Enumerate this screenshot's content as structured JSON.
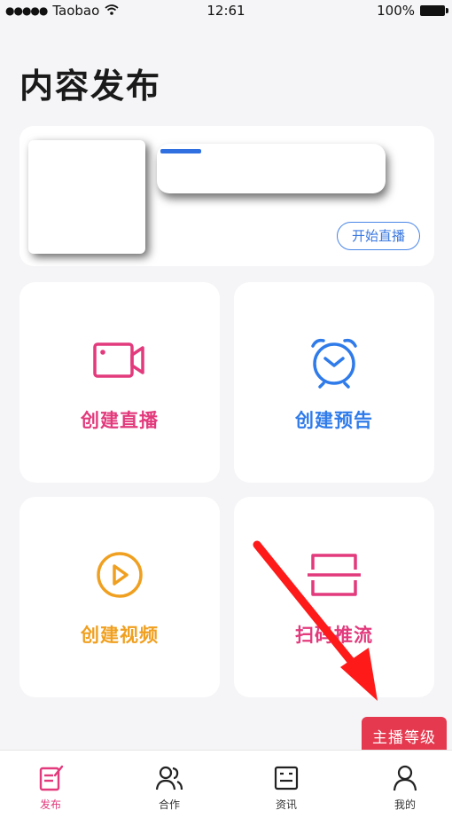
{
  "status_bar": {
    "carrier": "Taobao",
    "time": "12:61",
    "battery": "100%"
  },
  "page": {
    "title": "内容发布"
  },
  "live_card": {
    "start_button": "开始直播"
  },
  "tiles": [
    {
      "label": "创建直播",
      "icon": "video-camera-icon",
      "color": "#e23a7c"
    },
    {
      "label": "创建预告",
      "icon": "alarm-clock-icon",
      "color": "#2f7bea"
    },
    {
      "label": "创建视频",
      "icon": "play-circle-icon",
      "color": "#f0a020"
    },
    {
      "label": "扫码推流",
      "icon": "scan-frame-icon",
      "color": "#e23a7c"
    }
  ],
  "badge": {
    "label": "主播等级"
  },
  "tabbar": {
    "items": [
      {
        "label": "发布",
        "icon": "edit-note-icon",
        "active": true
      },
      {
        "label": "合作",
        "icon": "users-icon",
        "active": false
      },
      {
        "label": "资讯",
        "icon": "news-icon",
        "active": false
      },
      {
        "label": "我的",
        "icon": "person-icon",
        "active": false
      }
    ],
    "active_color": "#e23a7c"
  }
}
